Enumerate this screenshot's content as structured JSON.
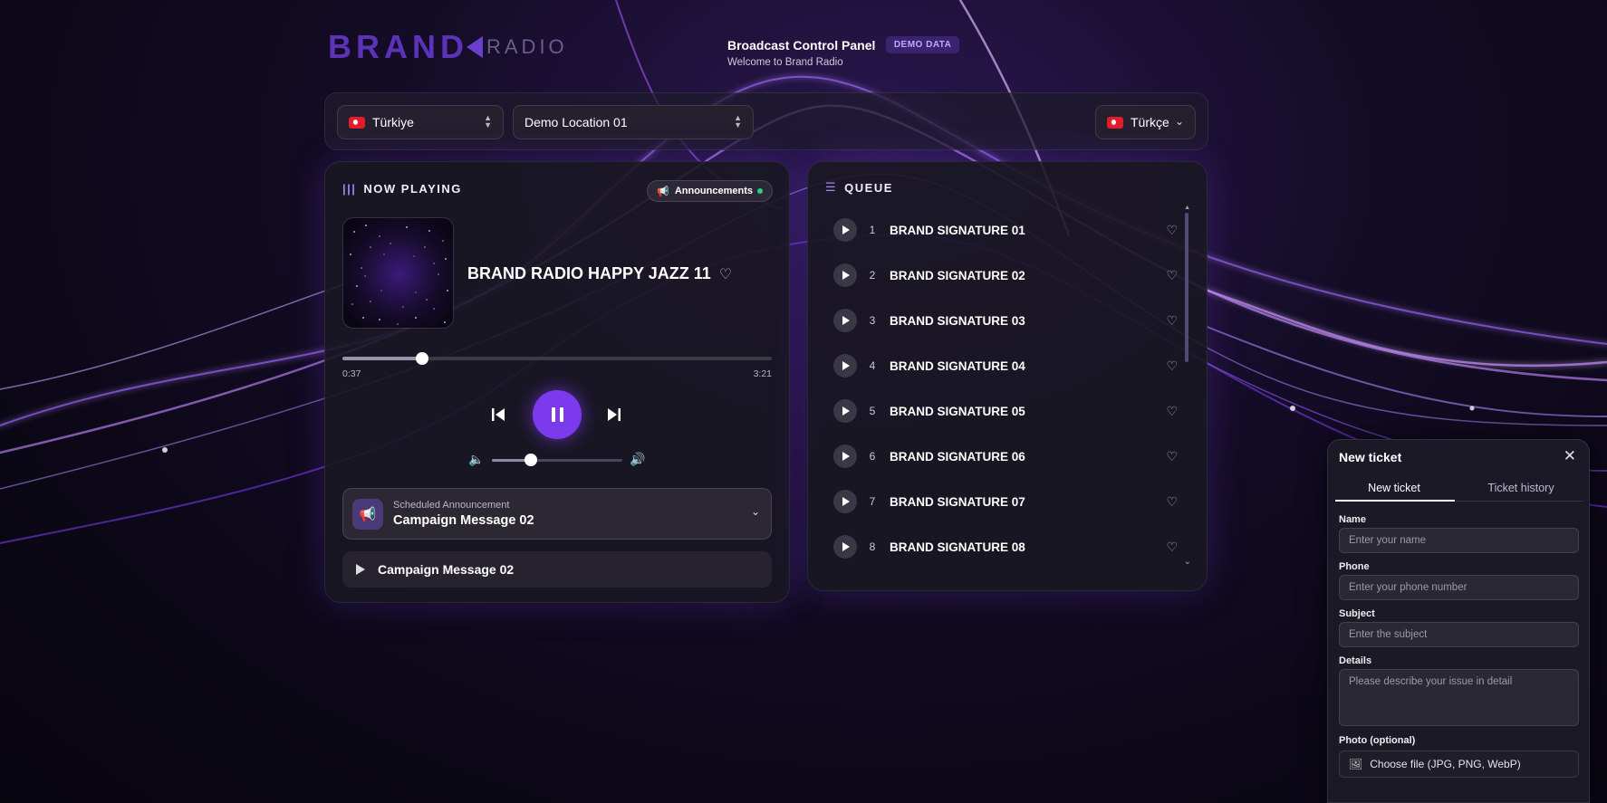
{
  "brand": {
    "logo_main": "BRAND",
    "logo_sub": "RADIO"
  },
  "header": {
    "title": "Broadcast Control Panel",
    "badge": "DEMO DATA",
    "subtitle": "Welcome to Brand Radio"
  },
  "selectors": {
    "country": "Türkiye",
    "location": "Demo Location 01",
    "language": "Türkçe"
  },
  "now_playing": {
    "section_title": "NOW PLAYING",
    "announcements_label": "Announcements",
    "track_title": "BRAND RADIO HAPPY JAZZ 11",
    "elapsed": "0:37",
    "duration": "3:21",
    "progress_fraction": 0.185,
    "volume_fraction": 0.3,
    "scheduled_label": "Scheduled Announcement",
    "scheduled_value": "Campaign Message 02",
    "campaign_item": "Campaign Message 02"
  },
  "queue": {
    "section_title": "QUEUE",
    "items": [
      {
        "num": "1",
        "name": "BRAND SIGNATURE 01"
      },
      {
        "num": "2",
        "name": "BRAND SIGNATURE 02"
      },
      {
        "num": "3",
        "name": "BRAND SIGNATURE 03"
      },
      {
        "num": "4",
        "name": "BRAND SIGNATURE 04"
      },
      {
        "num": "5",
        "name": "BRAND SIGNATURE 05"
      },
      {
        "num": "6",
        "name": "BRAND SIGNATURE 06"
      },
      {
        "num": "7",
        "name": "BRAND SIGNATURE 07"
      },
      {
        "num": "8",
        "name": "BRAND SIGNATURE 08"
      }
    ]
  },
  "ticket": {
    "title": "New ticket",
    "tabs": [
      "New ticket",
      "Ticket history"
    ],
    "name_label": "Name",
    "name_placeholder": "Enter your name",
    "phone_label": "Phone",
    "phone_placeholder": "Enter your phone number",
    "subject_label": "Subject",
    "subject_placeholder": "Enter the subject",
    "details_label": "Details",
    "details_placeholder": "Please describe your issue in detail",
    "photo_label": "Photo (optional)",
    "file_button": "Choose file (JPG, PNG, WebP)"
  },
  "colors": {
    "accent": "#7c3aed",
    "background": "#0c0818",
    "online": "#2ecc8a"
  },
  "icons": [
    "waveform-icon",
    "megaphone-icon",
    "heart-icon",
    "skip-back-icon",
    "pause-icon",
    "skip-forward-icon",
    "volume-low-icon",
    "volume-high-icon",
    "chevron-down-icon",
    "play-icon",
    "queue-list-icon",
    "close-icon",
    "image-file-icon",
    "flag-tr-icon"
  ]
}
